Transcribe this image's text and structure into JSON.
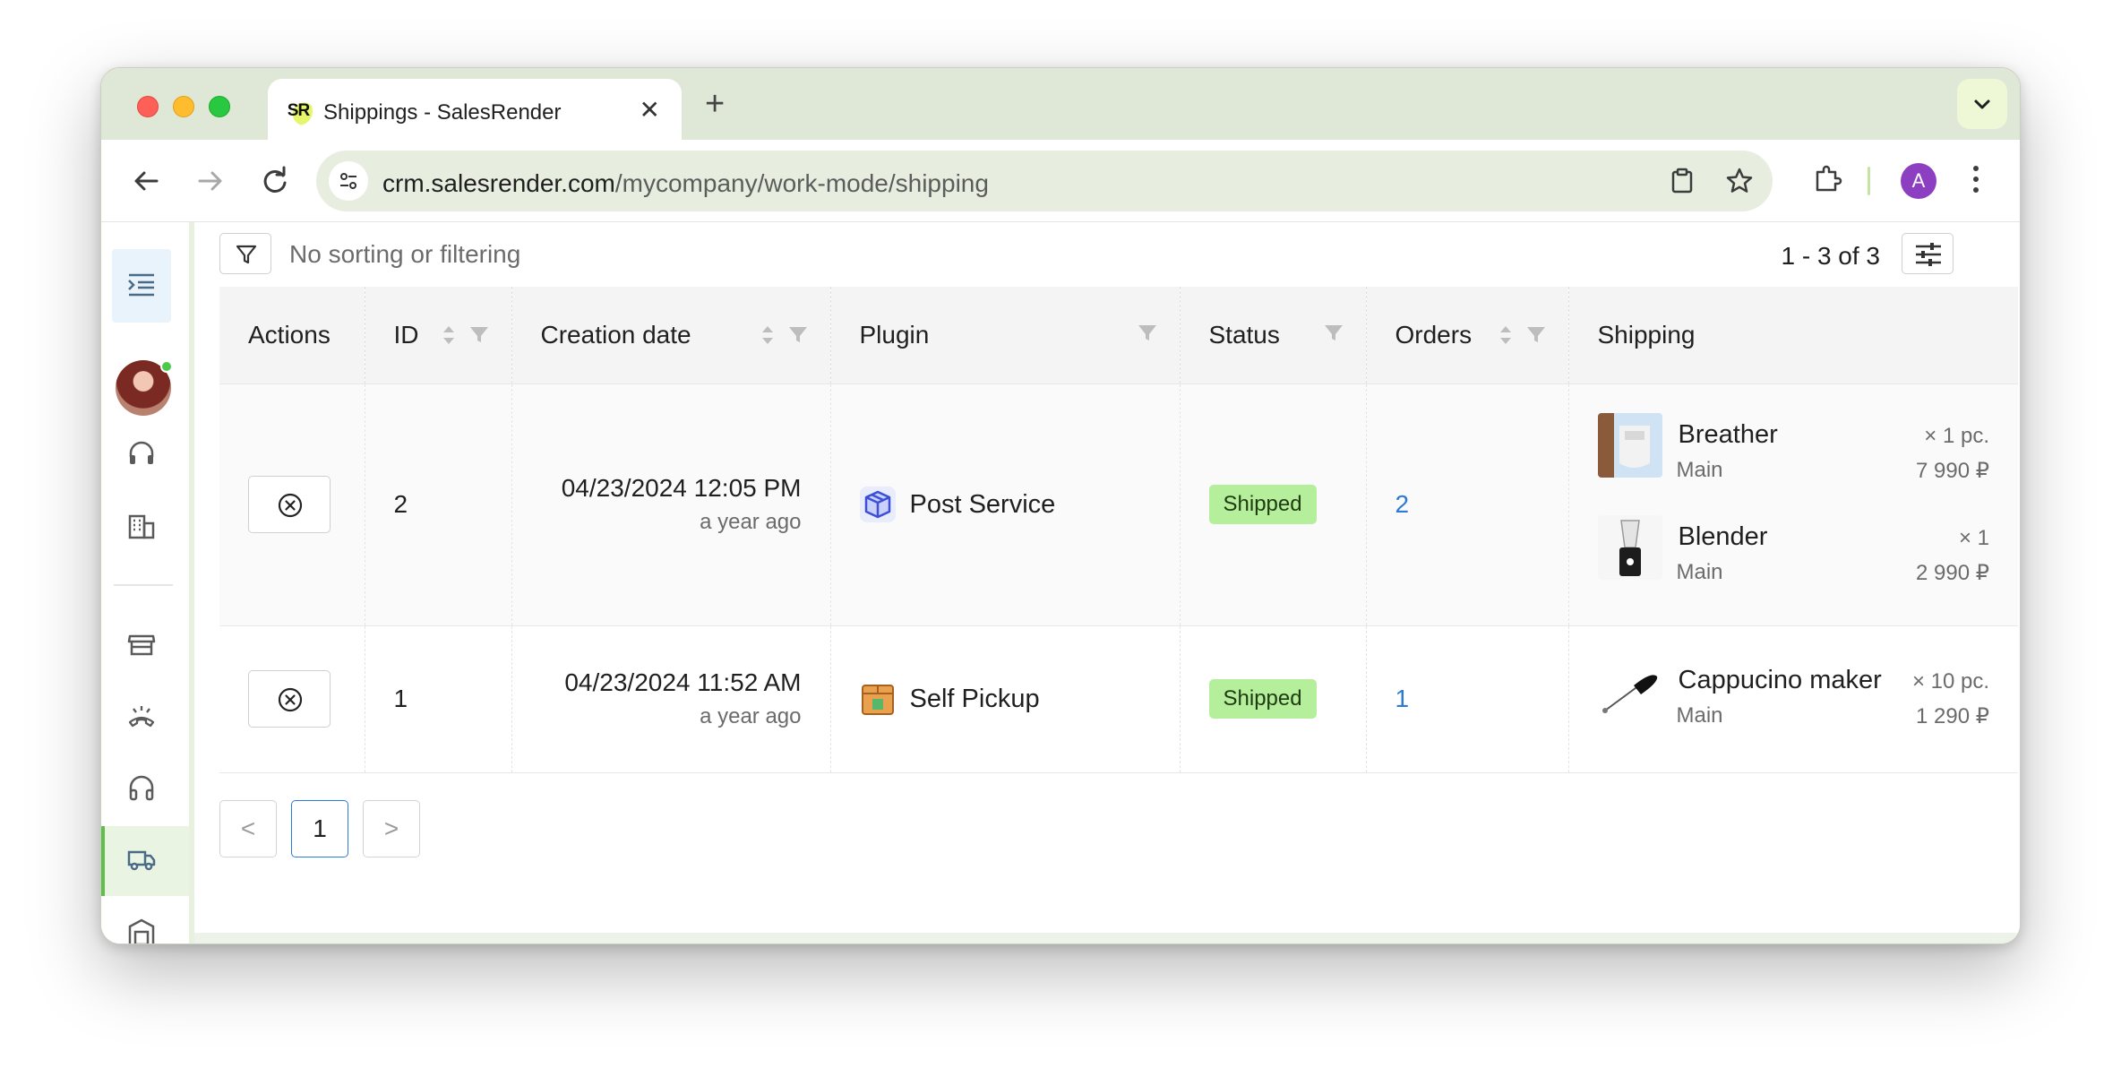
{
  "browser": {
    "tab_title": "Shippings - SalesRender",
    "favicon_text": "SR",
    "url_host": "crm.salesrender.com",
    "url_path": "/mycompany/work-mode/shipping",
    "profile_initial": "A"
  },
  "toolbar": {
    "filter_label": "No sorting or filtering",
    "range_label": "1 - 3 of 3"
  },
  "table": {
    "columns": [
      "Actions",
      "ID",
      "Creation date",
      "Plugin",
      "Status",
      "Orders",
      "Shipping"
    ],
    "rows": [
      {
        "id": "2",
        "date": "04/23/2024 12:05 PM",
        "date_relative": "a year ago",
        "plugin": "Post Service",
        "status": "Shipped",
        "orders": "2",
        "items": [
          {
            "name": "Breather",
            "sub": "Main",
            "qty": "× 1 pc.",
            "price": "7 990 ₽"
          },
          {
            "name": "Blender",
            "sub": "Main",
            "qty": "× 1",
            "price": "2 990 ₽"
          }
        ]
      },
      {
        "id": "1",
        "date": "04/23/2024 11:52 AM",
        "date_relative": "a year ago",
        "plugin": "Self Pickup",
        "status": "Shipped",
        "orders": "1",
        "items": [
          {
            "name": "Cappucino maker",
            "sub": "Main",
            "qty": "× 10 pc.",
            "price": "1 290 ₽"
          }
        ]
      }
    ]
  },
  "pagination": {
    "prev": "<",
    "current": "1",
    "next": ">"
  },
  "colors": {
    "accent_green": "#5fbf4a",
    "badge_green": "#b6ef9c",
    "link_blue": "#2d7bd6"
  }
}
